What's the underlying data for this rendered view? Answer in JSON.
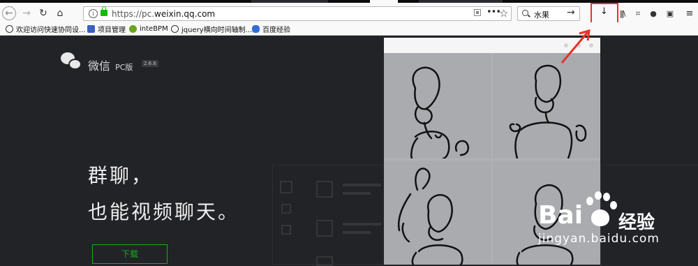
{
  "browser": {
    "url_prefix": "https://pc.",
    "url_domain": "weixin.qq.com",
    "search_query": "水果",
    "dots_label": "•••",
    "star_label": "☆"
  },
  "bookmarks": [
    {
      "label": "欢迎访问快速协同设...",
      "icon": "globe-icon"
    },
    {
      "label": "项目管理",
      "icon": "dragon-icon"
    },
    {
      "label": "inteBPM",
      "icon": "green-circle-icon"
    },
    {
      "label": "jquery横向时间轴制...",
      "icon": "globe-icon"
    },
    {
      "label": "百度经验",
      "icon": "paw-icon"
    }
  ],
  "page": {
    "brand_name": "微信",
    "brand_pc": "PC版",
    "version": "2.6.6",
    "headline_1": "群聊，",
    "headline_2": "也能视频聊天。",
    "download_button": "下载"
  },
  "watermark": {
    "word_bai": "Bai",
    "word_du": "du",
    "cn": "经验",
    "site": "jingyan.baidu.com"
  },
  "colors": {
    "accent_green": "#1aad19",
    "highlight_red": "#e8322a",
    "page_bg": "#222327"
  }
}
